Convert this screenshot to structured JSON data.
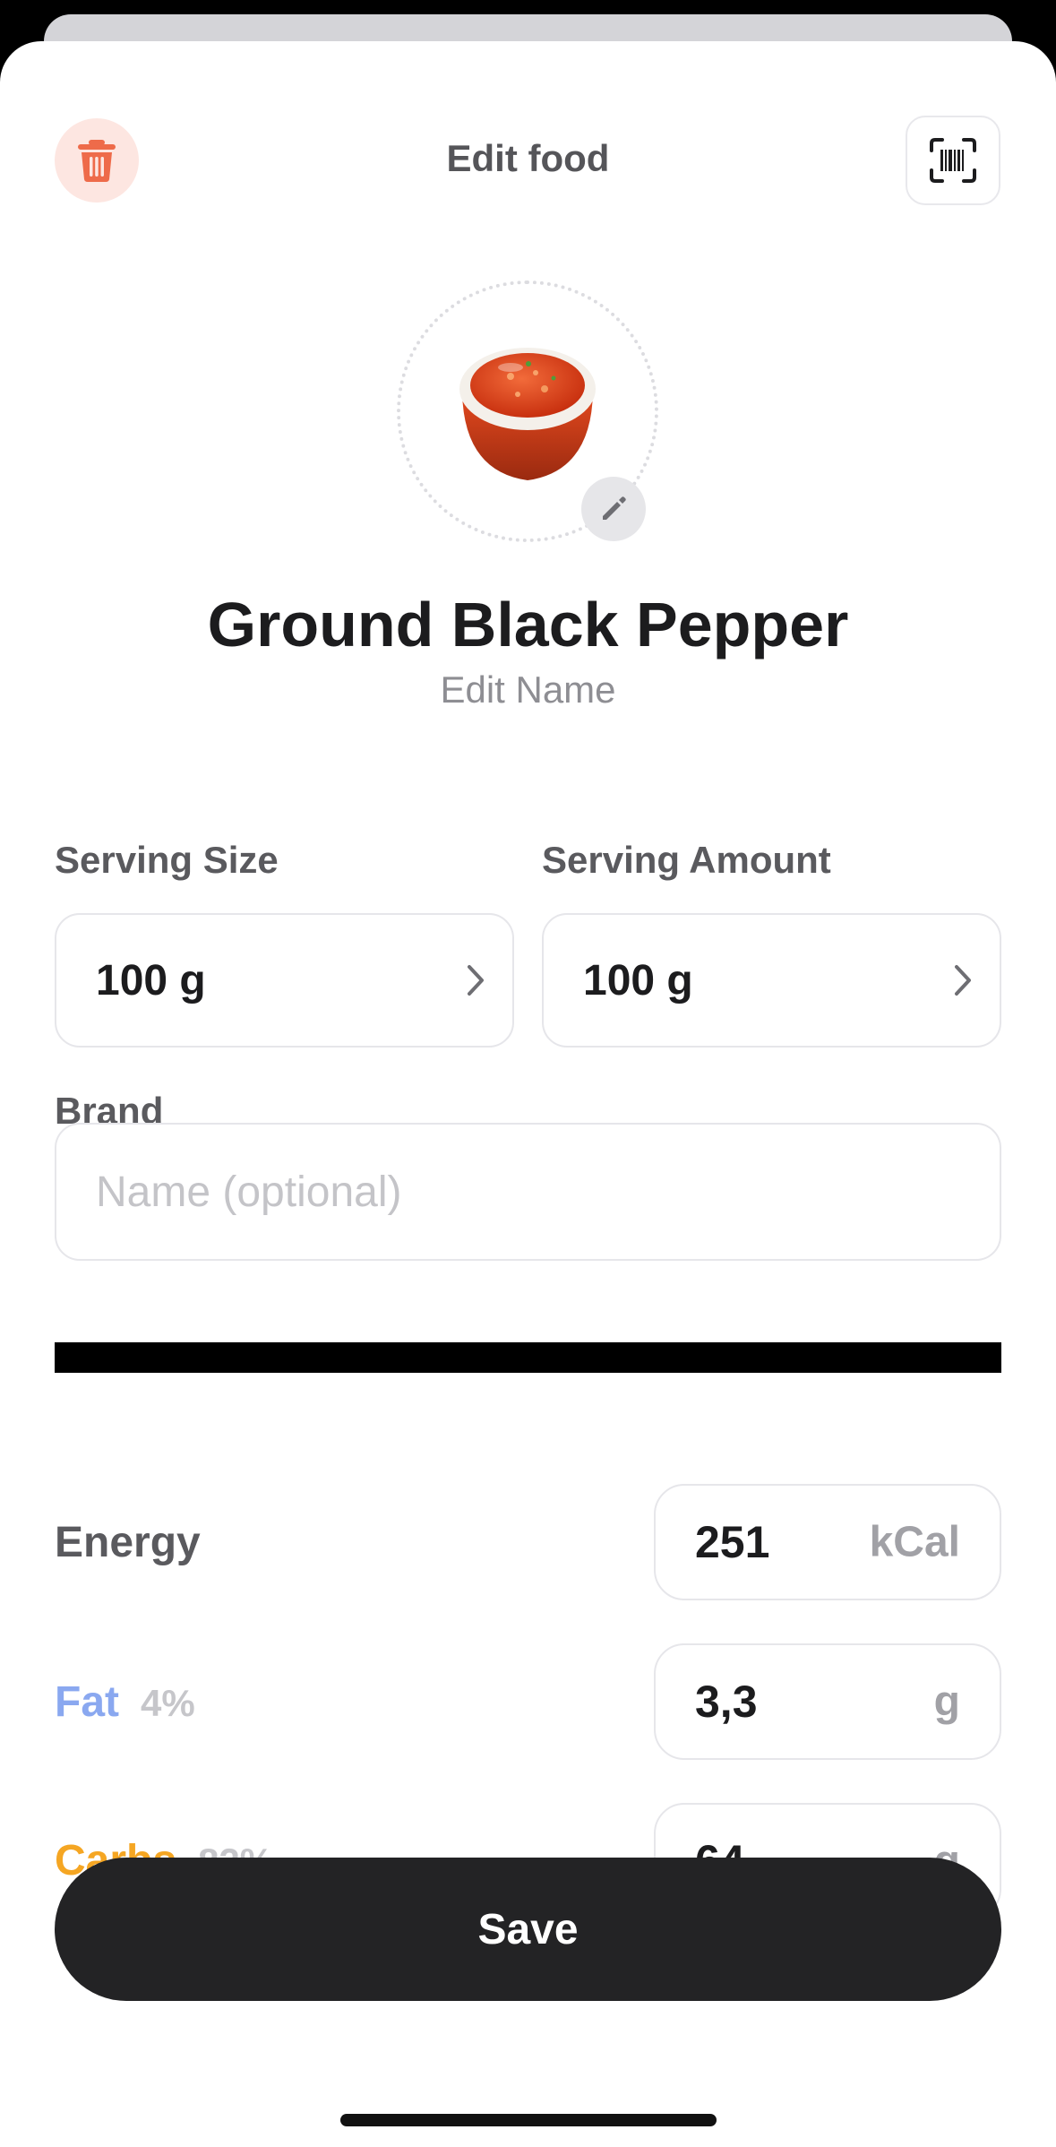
{
  "header": {
    "title": "Edit food",
    "delete_icon": "trash-icon",
    "scan_icon": "barcode-scan-icon"
  },
  "food": {
    "name": "Ground Black Pepper",
    "edit_name_label": "Edit Name",
    "image_icon": "sauce-bowl-image",
    "edit_photo_icon": "pencil-icon"
  },
  "serving": {
    "size_label": "Serving Size",
    "size_value": "100 g",
    "amount_label": "Serving Amount",
    "amount_value": "100 g"
  },
  "brand": {
    "label": "Brand",
    "placeholder": "Name (optional)"
  },
  "nutrients": {
    "energy": {
      "label": "Energy",
      "value": "251",
      "unit": "kCal"
    },
    "fat": {
      "label": "Fat",
      "percent": "4%",
      "value": "3,3",
      "unit": "g",
      "color": "#8aa8f0"
    },
    "carbs": {
      "label": "Carbs",
      "percent": "82%",
      "value": "64",
      "unit": "g",
      "color": "#f5a623"
    }
  },
  "actions": {
    "save_label": "Save"
  },
  "colors": {
    "accent_red": "#ee6b4a",
    "button_dark": "#232325"
  }
}
